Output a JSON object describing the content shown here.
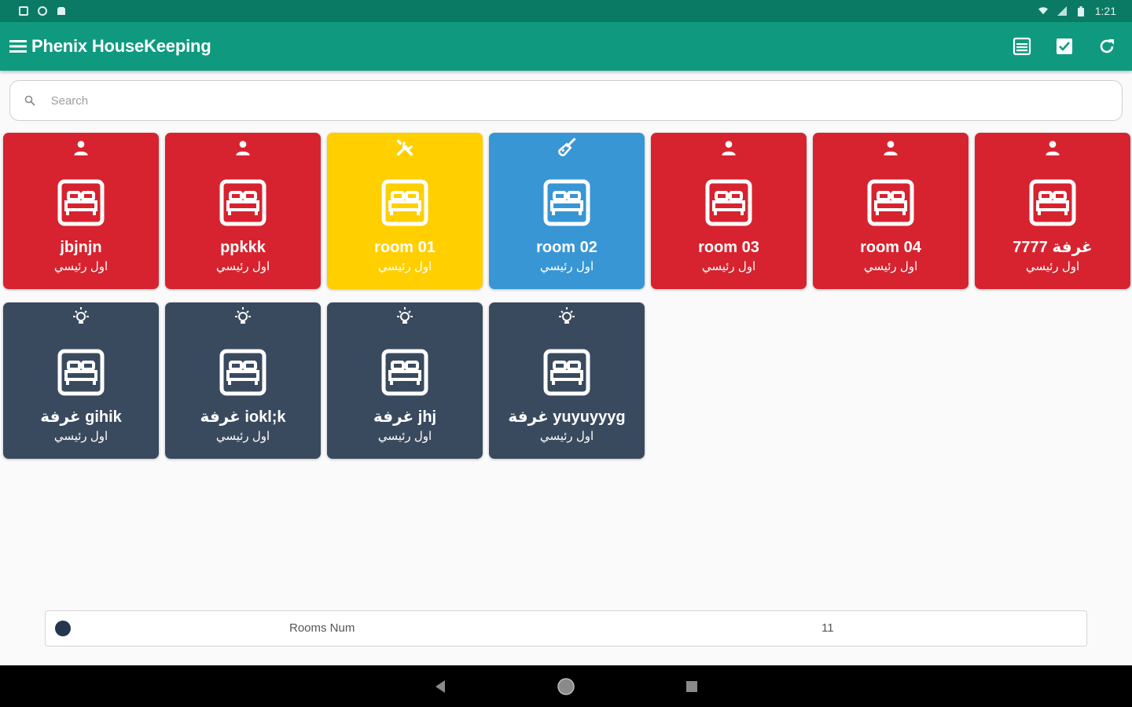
{
  "status_bar": {
    "time": "1:21"
  },
  "app_bar": {
    "title": "Phenix HouseKeeping",
    "actions": [
      "receipt-icon",
      "checkbox-icon",
      "refresh-icon"
    ]
  },
  "search": {
    "placeholder": "Search",
    "value": ""
  },
  "colors": {
    "app_bar": "#0f9a80",
    "status_bar": "#0b7a64",
    "occupied": "#d7232f",
    "maintenance": "#ffcf00",
    "cleaning": "#3996d4",
    "vacant": "#3a4a5e",
    "legend_dot": "#25364f"
  },
  "rooms": [
    {
      "name": "jbjnjn",
      "subtitle": "اول رئيسي",
      "status": "occupied",
      "status_icon": "person-icon"
    },
    {
      "name": "ppkkk",
      "subtitle": "اول رئيسي",
      "status": "occupied",
      "status_icon": "person-icon"
    },
    {
      "name": "room 01",
      "subtitle": "اول رئيسي",
      "status": "maintenance",
      "status_icon": "tools-icon"
    },
    {
      "name": "room 02",
      "subtitle": "اول رئيسي",
      "status": "cleaning",
      "status_icon": "broom-icon"
    },
    {
      "name": "room 03",
      "subtitle": "اول رئيسي",
      "status": "occupied",
      "status_icon": "person-icon"
    },
    {
      "name": "room 04",
      "subtitle": "اول رئيسي",
      "status": "occupied",
      "status_icon": "person-icon"
    },
    {
      "name": "غرفة 7777",
      "subtitle": "اول رئيسي",
      "status": "occupied",
      "status_icon": "person-icon"
    },
    {
      "name": "غرفة gihik",
      "subtitle": "اول رئيسي",
      "status": "vacant",
      "status_icon": "lightbulb-icon"
    },
    {
      "name": "غرفة iokl;k",
      "subtitle": "اول رئيسي",
      "status": "vacant",
      "status_icon": "lightbulb-icon"
    },
    {
      "name": "غرفة jhj",
      "subtitle": "اول رئيسي",
      "status": "vacant",
      "status_icon": "lightbulb-icon"
    },
    {
      "name": "غرفة yuyuyyyg",
      "subtitle": "اول رئيسي",
      "status": "vacant",
      "status_icon": "lightbulb-icon"
    }
  ],
  "footer": {
    "label": "Rooms Num",
    "count": "11"
  }
}
